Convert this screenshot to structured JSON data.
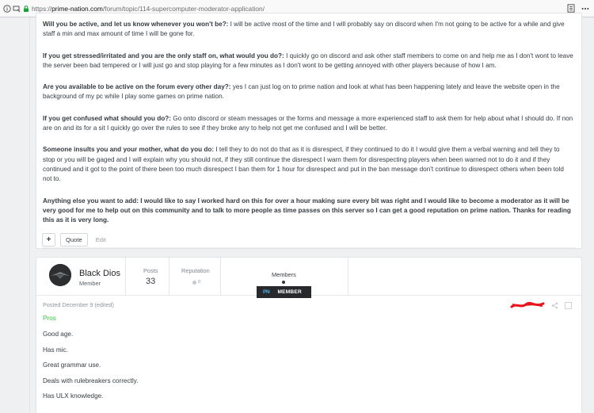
{
  "browser": {
    "url_scheme": "https://",
    "url_host": "prime-nation.com",
    "url_path": "/forum/topic/114-supercomputer-moderator-application/"
  },
  "post1": {
    "qa": [
      {
        "q": "Will you be active, and let us know whenever you won't be?:",
        "a": " I will be active most of the time and I will probably say on discord when I'm not going to be active for a while and give staff a min and max amount of time I will be gone for."
      },
      {
        "q": "If you get stressed/irritated and you are the only staff on, what would you do?:",
        "a": " I quickly go on discord and ask other staff members to come on and help me as I don't wont to leave the server been bad tempered or I will just go and stop playing for a few minutes as I don't wont to be getting annoyed with other players because of how I am."
      },
      {
        "q": "Are you available to be active on the forum every other day?:",
        "a": " yes I can just log on to prime nation and look at what has been happening lately and leave the website open in the background of my pc while I play some games on prime nation."
      },
      {
        "q": "If you get confused what should you do?:",
        "a": " Go onto discord or steam messages or the forms and message a more experienced staff to ask them for help about what I should do. If non are on and its for a sit I quickly go over the rules to see if they broke any to help not get me confused and I will be better."
      },
      {
        "q": "Someone insults you and your mother, what do you do:",
        "a": " I tell they to do not do that as it is disrespect, if they continued to do it I would give them a verbal warning and tell they to stop or you will be gaged and I will explain why you should not, if they still continue the disrespect I warn them for disrespecting players when been warned not to do it and if they continued and it got to the point of there been too much disrespect I ban them for 1 hour for disrespect and put in the ban message don't continue to disrespect others when been told not to."
      },
      {
        "q": "Anything else you want to add:",
        "a": " I would like to say I worked hard on this for over a hour making sure every bit was right and I would like to become a moderator as it will be very good for me to help out on this community and to talk to more people as time passes on this server so I can get a good reputation on prime nation. Thanks for reading this as it is very long."
      }
    ],
    "actions": {
      "plus": "+",
      "quote": "Quote",
      "edit": "Edit"
    }
  },
  "post2": {
    "author": {
      "name": "Black Dios",
      "group": "Member"
    },
    "stats": {
      "posts_label": "Posts",
      "posts_value": "33",
      "reputation_label": "Reputation",
      "reputation_value": "0"
    },
    "members_label": "Members",
    "badge": {
      "logo": "PN",
      "text": "MEMBER"
    },
    "posted": "Posted December 9 (edited)",
    "body": {
      "heading": "Pros",
      "lines": [
        "Good age.",
        "Has mic.",
        "Great grammar use.",
        "Deals with rulebreakers correctly.",
        "Has ULX knowledge."
      ]
    }
  },
  "colors": {
    "accent_green": "#2ecc40",
    "badge_bg": "#27292c",
    "scribble_red": "#e8141c"
  },
  "icons": [
    "info-icon",
    "tracking-protection-icon",
    "lock-icon",
    "reader-view-icon",
    "menu-dots-icon",
    "share-icon",
    "checkbox-icon"
  ]
}
